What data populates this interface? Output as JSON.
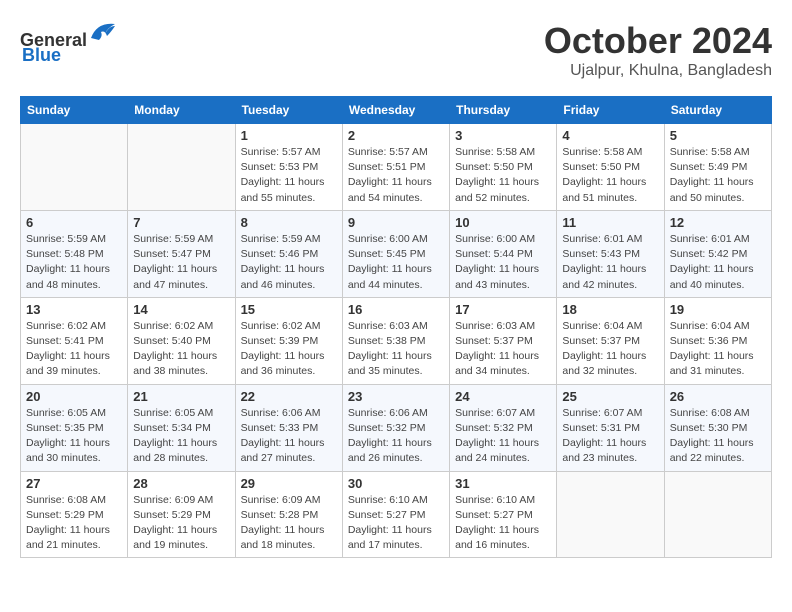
{
  "header": {
    "logo_line1": "General",
    "logo_line2": "Blue",
    "month": "October 2024",
    "location": "Ujalpur, Khulna, Bangladesh"
  },
  "weekdays": [
    "Sunday",
    "Monday",
    "Tuesday",
    "Wednesday",
    "Thursday",
    "Friday",
    "Saturday"
  ],
  "weeks": [
    [
      {
        "day": "",
        "info": ""
      },
      {
        "day": "",
        "info": ""
      },
      {
        "day": "1",
        "info": "Sunrise: 5:57 AM\nSunset: 5:53 PM\nDaylight: 11 hours and 55 minutes."
      },
      {
        "day": "2",
        "info": "Sunrise: 5:57 AM\nSunset: 5:51 PM\nDaylight: 11 hours and 54 minutes."
      },
      {
        "day": "3",
        "info": "Sunrise: 5:58 AM\nSunset: 5:50 PM\nDaylight: 11 hours and 52 minutes."
      },
      {
        "day": "4",
        "info": "Sunrise: 5:58 AM\nSunset: 5:50 PM\nDaylight: 11 hours and 51 minutes."
      },
      {
        "day": "5",
        "info": "Sunrise: 5:58 AM\nSunset: 5:49 PM\nDaylight: 11 hours and 50 minutes."
      }
    ],
    [
      {
        "day": "6",
        "info": "Sunrise: 5:59 AM\nSunset: 5:48 PM\nDaylight: 11 hours and 48 minutes."
      },
      {
        "day": "7",
        "info": "Sunrise: 5:59 AM\nSunset: 5:47 PM\nDaylight: 11 hours and 47 minutes."
      },
      {
        "day": "8",
        "info": "Sunrise: 5:59 AM\nSunset: 5:46 PM\nDaylight: 11 hours and 46 minutes."
      },
      {
        "day": "9",
        "info": "Sunrise: 6:00 AM\nSunset: 5:45 PM\nDaylight: 11 hours and 44 minutes."
      },
      {
        "day": "10",
        "info": "Sunrise: 6:00 AM\nSunset: 5:44 PM\nDaylight: 11 hours and 43 minutes."
      },
      {
        "day": "11",
        "info": "Sunrise: 6:01 AM\nSunset: 5:43 PM\nDaylight: 11 hours and 42 minutes."
      },
      {
        "day": "12",
        "info": "Sunrise: 6:01 AM\nSunset: 5:42 PM\nDaylight: 11 hours and 40 minutes."
      }
    ],
    [
      {
        "day": "13",
        "info": "Sunrise: 6:02 AM\nSunset: 5:41 PM\nDaylight: 11 hours and 39 minutes."
      },
      {
        "day": "14",
        "info": "Sunrise: 6:02 AM\nSunset: 5:40 PM\nDaylight: 11 hours and 38 minutes."
      },
      {
        "day": "15",
        "info": "Sunrise: 6:02 AM\nSunset: 5:39 PM\nDaylight: 11 hours and 36 minutes."
      },
      {
        "day": "16",
        "info": "Sunrise: 6:03 AM\nSunset: 5:38 PM\nDaylight: 11 hours and 35 minutes."
      },
      {
        "day": "17",
        "info": "Sunrise: 6:03 AM\nSunset: 5:37 PM\nDaylight: 11 hours and 34 minutes."
      },
      {
        "day": "18",
        "info": "Sunrise: 6:04 AM\nSunset: 5:37 PM\nDaylight: 11 hours and 32 minutes."
      },
      {
        "day": "19",
        "info": "Sunrise: 6:04 AM\nSunset: 5:36 PM\nDaylight: 11 hours and 31 minutes."
      }
    ],
    [
      {
        "day": "20",
        "info": "Sunrise: 6:05 AM\nSunset: 5:35 PM\nDaylight: 11 hours and 30 minutes."
      },
      {
        "day": "21",
        "info": "Sunrise: 6:05 AM\nSunset: 5:34 PM\nDaylight: 11 hours and 28 minutes."
      },
      {
        "day": "22",
        "info": "Sunrise: 6:06 AM\nSunset: 5:33 PM\nDaylight: 11 hours and 27 minutes."
      },
      {
        "day": "23",
        "info": "Sunrise: 6:06 AM\nSunset: 5:32 PM\nDaylight: 11 hours and 26 minutes."
      },
      {
        "day": "24",
        "info": "Sunrise: 6:07 AM\nSunset: 5:32 PM\nDaylight: 11 hours and 24 minutes."
      },
      {
        "day": "25",
        "info": "Sunrise: 6:07 AM\nSunset: 5:31 PM\nDaylight: 11 hours and 23 minutes."
      },
      {
        "day": "26",
        "info": "Sunrise: 6:08 AM\nSunset: 5:30 PM\nDaylight: 11 hours and 22 minutes."
      }
    ],
    [
      {
        "day": "27",
        "info": "Sunrise: 6:08 AM\nSunset: 5:29 PM\nDaylight: 11 hours and 21 minutes."
      },
      {
        "day": "28",
        "info": "Sunrise: 6:09 AM\nSunset: 5:29 PM\nDaylight: 11 hours and 19 minutes."
      },
      {
        "day": "29",
        "info": "Sunrise: 6:09 AM\nSunset: 5:28 PM\nDaylight: 11 hours and 18 minutes."
      },
      {
        "day": "30",
        "info": "Sunrise: 6:10 AM\nSunset: 5:27 PM\nDaylight: 11 hours and 17 minutes."
      },
      {
        "day": "31",
        "info": "Sunrise: 6:10 AM\nSunset: 5:27 PM\nDaylight: 11 hours and 16 minutes."
      },
      {
        "day": "",
        "info": ""
      },
      {
        "day": "",
        "info": ""
      }
    ]
  ]
}
